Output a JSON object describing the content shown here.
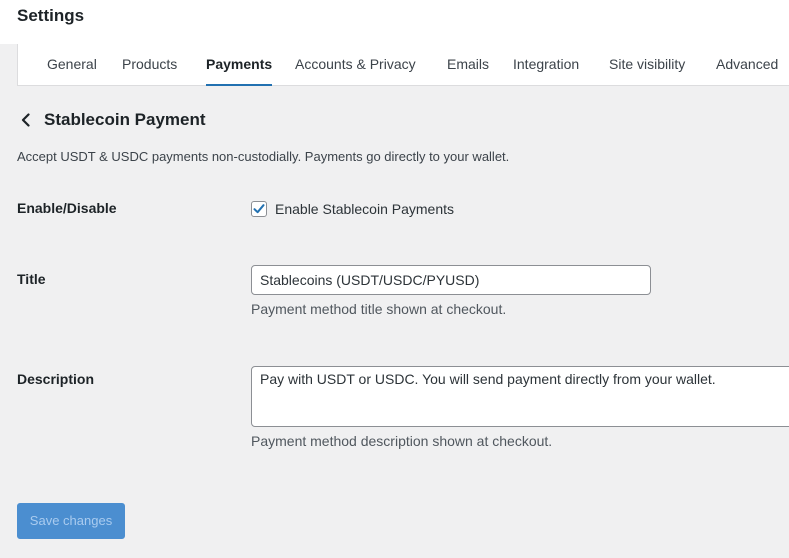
{
  "header": {
    "title": "Settings"
  },
  "tabs": [
    {
      "label": "General"
    },
    {
      "label": "Products"
    },
    {
      "label": "Payments",
      "active": true
    },
    {
      "label": "Accounts & Privacy"
    },
    {
      "label": "Emails"
    },
    {
      "label": "Integration"
    },
    {
      "label": "Site visibility"
    },
    {
      "label": "Advanced"
    }
  ],
  "section": {
    "back_icon": "chevron-left-icon",
    "title": "Stablecoin Payment",
    "intro": "Accept USDT & USDC payments non-custodially. Payments go directly to your wallet."
  },
  "fields": {
    "enable": {
      "label": "Enable/Disable",
      "checkbox_label": "Enable Stablecoin Payments",
      "checked": true
    },
    "title": {
      "label": "Title",
      "value": "Stablecoins (USDT/USDC/PYUSD)",
      "help": "Payment method title shown at checkout."
    },
    "description": {
      "label": "Description",
      "value": "Pay with USDT or USDC. You will send payment directly from your wallet.",
      "help": "Payment method description shown at checkout."
    }
  },
  "actions": {
    "save_label": "Save changes"
  },
  "colors": {
    "accent": "#2271b1",
    "button": "#4b8ed0",
    "background": "#f0f0f1"
  }
}
